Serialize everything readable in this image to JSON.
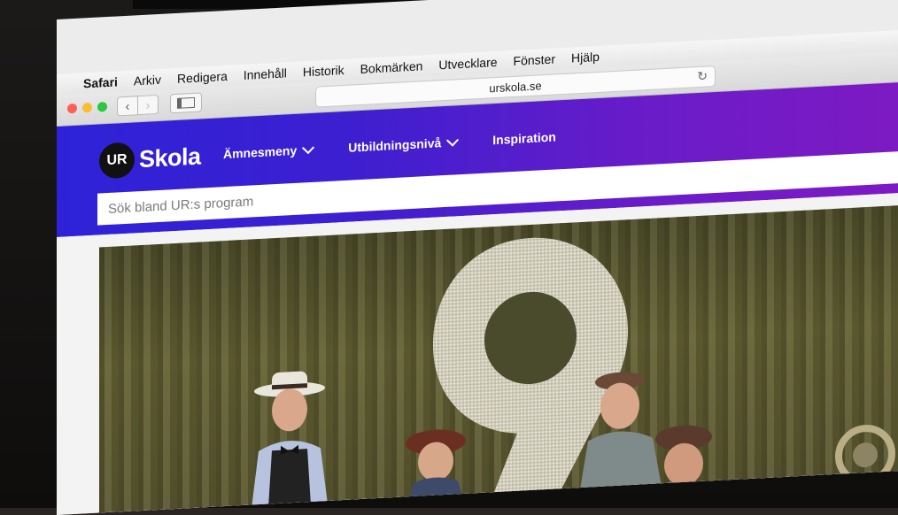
{
  "menubar": {
    "items": [
      "Safari",
      "Arkiv",
      "Redigera",
      "Innehåll",
      "Historik",
      "Bokmärken",
      "Utvecklare",
      "Fönster",
      "Hjälp"
    ]
  },
  "toolbar": {
    "url": "urskola.se"
  },
  "site": {
    "logo_badge": "UR",
    "logo_text": "Skola",
    "nav": [
      "Ämnesmeny",
      "Utbildningsnivå",
      "Inspiration"
    ],
    "search_placeholder": "Sök bland UR:s program"
  },
  "colors": {
    "header_gradient_start": "#2e22d8",
    "header_gradient_end": "#7e1ac3",
    "hero_curtain": "#5a5730"
  },
  "icons": {
    "apple": "apple-icon",
    "download": "download-icon",
    "reload": "reload-icon",
    "back": "chevron-left-icon",
    "forward": "chevron-right-icon",
    "sidebar": "sidebar-icon"
  }
}
